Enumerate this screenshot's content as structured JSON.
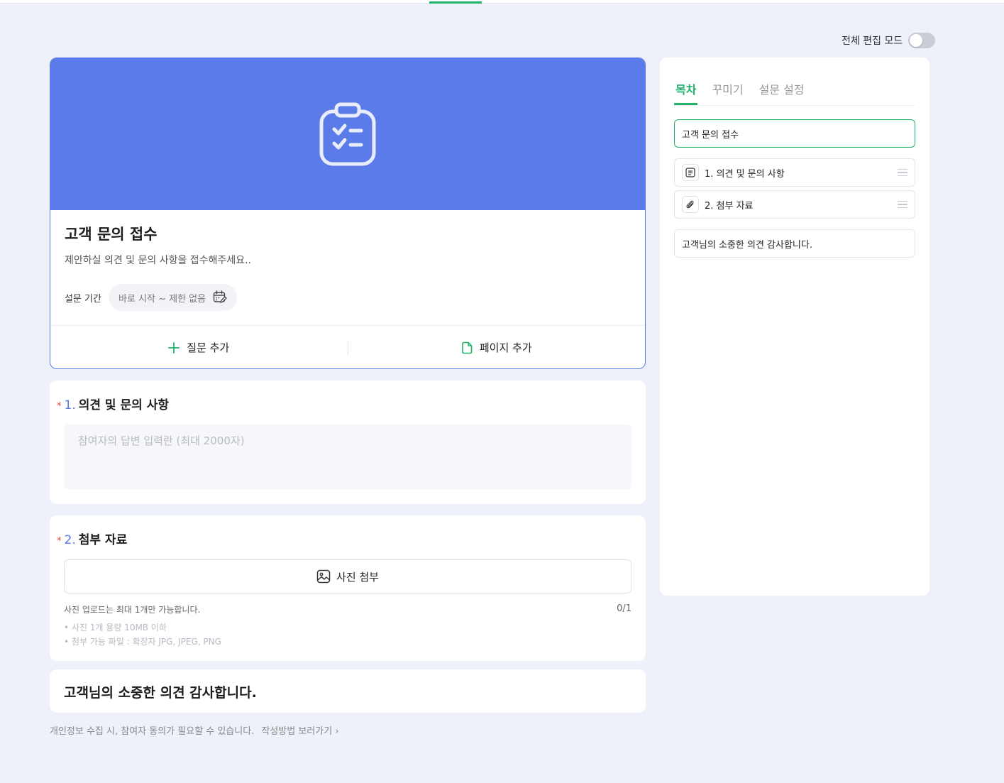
{
  "edit_mode": {
    "label": "전체 편집 모드",
    "enabled": false
  },
  "survey": {
    "title": "고객 문의 접수",
    "description": "제안하실 의견 및 문의 사항을 접수해주세요..",
    "period_label": "설문 기간",
    "period_value": "바로 시작 ~ 제한 없음",
    "add_question": "질문 추가",
    "add_page": "페이지 추가"
  },
  "questions": [
    {
      "required_mark": "*",
      "number": "1.",
      "title": "의견 및 문의 사항",
      "placeholder": "참여자의 답변 입력란 (최대 2000자)"
    },
    {
      "required_mark": "*",
      "number": "2.",
      "title": "첨부 자료",
      "photo_button": "사진 첨부",
      "upload_note": "사진 업로드는 최대 1개만 가능합니다.",
      "upload_count": "0/1",
      "spec_size": "사진 1개 용량 10MB 이하",
      "spec_types": "첨부 가능 파일 : 확장자 JPG, JPEG, PNG"
    }
  ],
  "end_message": "고객님의 소중한 의견 감사합니다.",
  "footer": {
    "note": "개인정보 수집 시, 참여자 동의가 필요할 수 있습니다.",
    "link": "작성방법 보러가기"
  },
  "sidebar": {
    "tabs": [
      "목차",
      "꾸미기",
      "설문 설정"
    ],
    "active_tab": "목차",
    "toc_title": "고객 문의 접수",
    "toc_items": [
      "1. 의견 및 문의 사항",
      "2. 첨부 자료"
    ],
    "toc_end": "고객님의 소중한 의견 감사합니다."
  },
  "colors": {
    "accent_green": "#21b26a",
    "cover_blue": "#5a7be8",
    "required_red": "#e53e3e"
  }
}
